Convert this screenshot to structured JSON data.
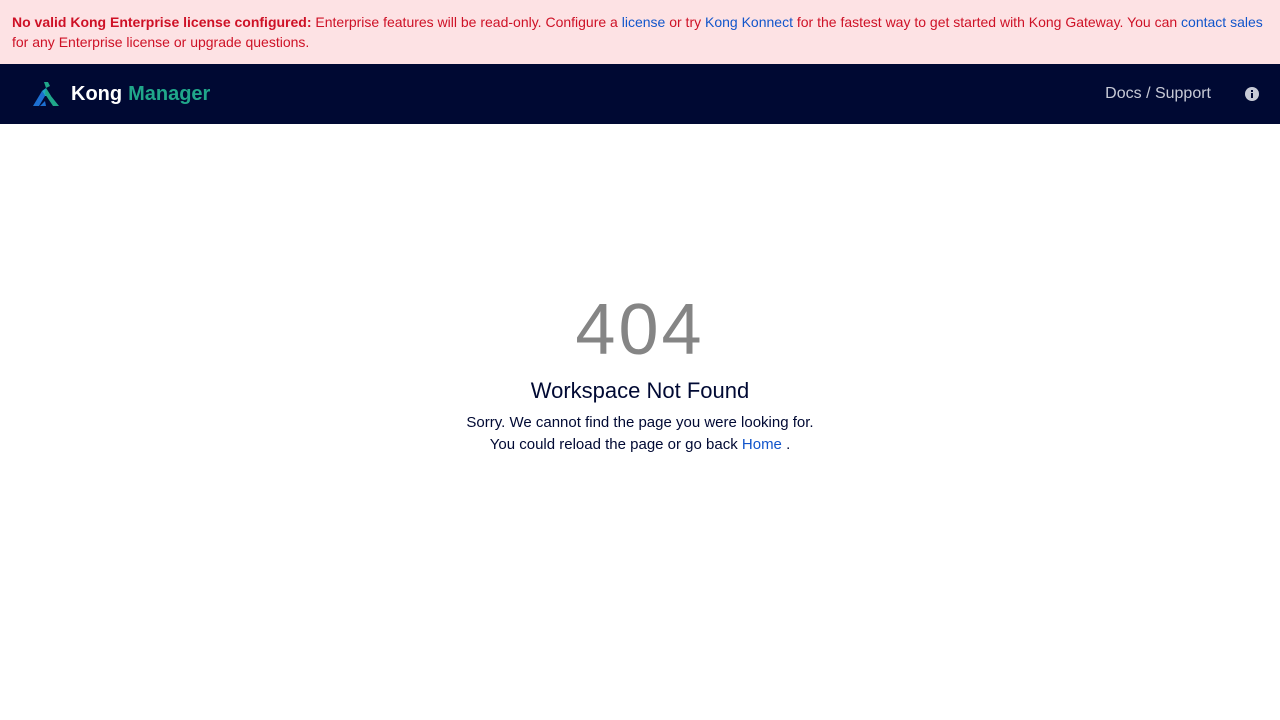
{
  "banner": {
    "strong": "No valid Kong Enterprise license configured:",
    "text1": " Enterprise features will be read-only. Configure a ",
    "license_link": "license",
    "text2": " or try ",
    "konnect_link": "Kong Konnect",
    "text3": " for the fastest way to get started with Kong Gateway. You can ",
    "sales_link": "contact sales",
    "text4": " for any Enterprise license or upgrade questions."
  },
  "navbar": {
    "brand_primary": "Kong",
    "brand_secondary": "Manager",
    "docs_label": "Docs / Support",
    "info_icon": "info-circle-icon"
  },
  "error": {
    "code": "404",
    "title": "Workspace Not Found",
    "message": "Sorry. We cannot find the page you were looking for. You could reload the page or go back ",
    "home_link": "Home",
    "message_end": " ."
  },
  "colors": {
    "banner_bg": "#fde2e4",
    "banner_text": "#ce1126",
    "link": "#1155cb",
    "navbar_bg": "#000933",
    "brand_accent": "#20a78a"
  }
}
